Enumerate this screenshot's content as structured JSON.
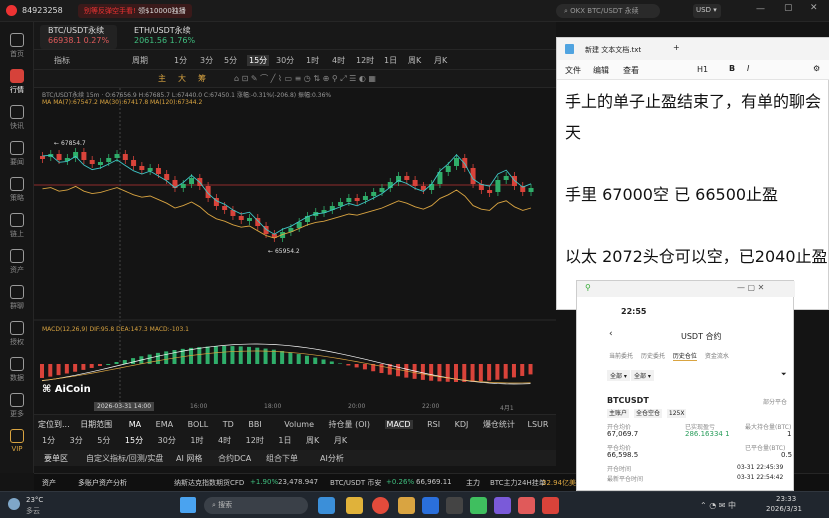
{
  "window": {
    "account_id": "84923258",
    "ad_text": "别等反弹空手看!",
    "ad_sub": "领$10000独播",
    "search_placeholder": "OKX BTC/USDT 永续",
    "currency": "USD"
  },
  "leftnav": [
    {
      "label": "首页",
      "icon": "home-icon"
    },
    {
      "label": "行情",
      "icon": "chart-icon"
    },
    {
      "label": "快讯",
      "icon": "news-icon"
    },
    {
      "label": "要闻",
      "icon": "article-icon"
    },
    {
      "label": "策略",
      "icon": "strategy-icon"
    },
    {
      "label": "链上",
      "icon": "chain-icon"
    },
    {
      "label": "资产",
      "icon": "wallet-icon"
    },
    {
      "label": "群聊",
      "icon": "chat-icon"
    },
    {
      "label": "授权",
      "icon": "key-icon"
    },
    {
      "label": "数据",
      "icon": "data-icon"
    },
    {
      "label": "更多",
      "icon": "more-icon"
    },
    {
      "label": "VIP",
      "icon": "vip-icon"
    }
  ],
  "tabs": [
    {
      "name": "BTC/USDT永续",
      "price": "66938.1 0.27%",
      "color": "#e05a5a"
    },
    {
      "name": "ETH/USDT永续",
      "price": "2061.56 1.76%",
      "color": "#3fbf7f"
    }
  ],
  "toolbar": {
    "items": [
      "指标",
      "周期",
      "1分",
      "3分",
      "5分",
      "15分",
      "30分",
      "1时",
      "4时",
      "12时",
      "1日",
      "周K",
      "月K"
    ],
    "signals": [
      "主",
      "大",
      "筹"
    ]
  },
  "chart_header": "BTC/USDT永续 15m · O:67656.9 H:67685.7 L:67440.0 C:67450.1 涨幅:-0.31%(-206.8) 振幅:0.36%",
  "ma_line": "MA  MA(7):67547.2  MA(30):67417.8  MA(120):67344.2",
  "macd_line": "MACD(12,26,9)  DIF:95.8  DEA:147.3  MACD:-103.1",
  "annotations": {
    "high": "67854.7",
    "low": "65954.2"
  },
  "time_axis": [
    "16:00",
    "18:00",
    "20:00",
    "22:00",
    "4月1"
  ],
  "crosshair_time": "2026-03-31 14:00",
  "brand": "AiCoin",
  "bottom_tabs": [
    "定位到...",
    "日期范围",
    "MA",
    "EMA",
    "BOLL",
    "TD",
    "BBI",
    "Volume",
    "持仓量 (OI)",
    "MACD",
    "RSI",
    "KDJ",
    "爆仓统计",
    "LSUR"
  ],
  "bottom_periods": [
    "1分",
    "3分",
    "5分",
    "15分",
    "30分",
    "1时",
    "4时",
    "12时",
    "1日",
    "周K",
    "月K"
  ],
  "asset_menu": [
    "要单区",
    "自定义指标/回测/实盘",
    "AI 网格",
    "合约DCA",
    "组合下单",
    "AI分析"
  ],
  "ticker": {
    "label": "资产",
    "multi": "多账户资产分析",
    "item1": "纳斯达克指数期货CFD",
    "item1_chg": "+1.90%",
    "item1_val": "23,478.947",
    "item2": "BTC/USDT 币安",
    "item2_chg": "+0.26%",
    "item2_val": "66,969.11",
    "main": "主力",
    "main_text": "BTC主力24H挂单",
    "main_val": "32.94亿美"
  },
  "notepad": {
    "title": "新建 文本文档.txt",
    "menu": [
      "文件",
      "编辑",
      "查看"
    ],
    "format": "H1",
    "paragraphs": [
      "手上的单子止盈结束了，有单的聊会天",
      "手里 67000空  已 66500止盈",
      "以太 2072头仓可以空，已2040止盈"
    ]
  },
  "phone": {
    "time": "22:55",
    "title": "USDT 合约",
    "tabs": [
      "当前委托",
      "历史委托",
      "历史仓位",
      "资金流水"
    ],
    "active_tab": "历史仓位",
    "filters": [
      "全部",
      "全部"
    ],
    "symbol": "BTCUSDT",
    "tags": [
      "主账户",
      "全仓空仓",
      "125X"
    ],
    "partial": "部分平仓",
    "fields": [
      {
        "k": "开仓均价",
        "v": "67,069.7"
      },
      {
        "k": "已实现盈亏",
        "v": "286.16334 1"
      },
      {
        "k": "最大持仓量(BTC)",
        "v": "1"
      },
      {
        "k": "平仓均价",
        "v": "66,598.5"
      },
      {
        "k": "已平仓量(BTC)",
        "v": "0.5"
      },
      {
        "k": "开仓时间",
        "v": "03-31 22:45:39"
      },
      {
        "k": "最新平仓时间",
        "v": "03-31 22:54:42"
      }
    ]
  },
  "taskbar": {
    "weather_temp": "23°C",
    "weather_desc": "多云",
    "search": "搜索",
    "clock_time": "23:33",
    "clock_date": "2026/3/31"
  }
}
